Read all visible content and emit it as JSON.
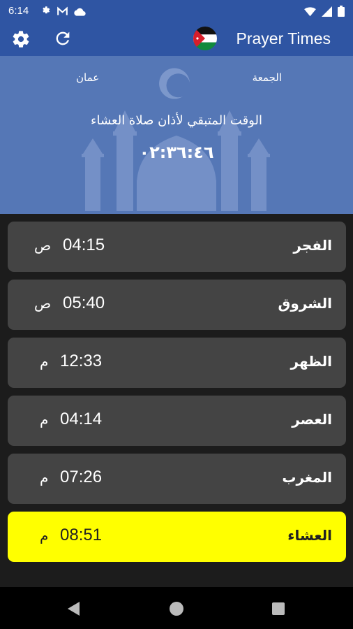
{
  "status_bar": {
    "time": "6:14",
    "left_icons": [
      "gear-icon",
      "gmail-icon",
      "cloud-icon"
    ],
    "right_icons": [
      "wifi-icon",
      "signal-icon",
      "battery-icon"
    ]
  },
  "app_bar": {
    "title": "Prayer Times",
    "flag": "jordan-flag",
    "settings_icon": "gear-icon",
    "refresh_icon": "refresh-icon"
  },
  "header": {
    "day": "الجمعة",
    "city": "عمان",
    "countdown_label": "الوقت المتبقي لأذان صلاة العشاء",
    "countdown": "٠٢:٣٦:٤٦"
  },
  "prayers": [
    {
      "name": "الفجر",
      "time": "04:15",
      "ampm": "ص",
      "active": false
    },
    {
      "name": "الشروق",
      "time": "05:40",
      "ampm": "ص",
      "active": false
    },
    {
      "name": "الظهر",
      "time": "12:33",
      "ampm": "م",
      "active": false
    },
    {
      "name": "العصر",
      "time": "04:14",
      "ampm": "م",
      "active": false
    },
    {
      "name": "المغرب",
      "time": "07:26",
      "ampm": "م",
      "active": false
    },
    {
      "name": "العشاء",
      "time": "08:51",
      "ampm": "م",
      "active": true
    }
  ],
  "colors": {
    "primary": "#2f55a3",
    "header_bg": "#5577b6",
    "row_bg": "#444444",
    "active_row": "#ffff00",
    "list_bg": "#1c1c1c"
  }
}
